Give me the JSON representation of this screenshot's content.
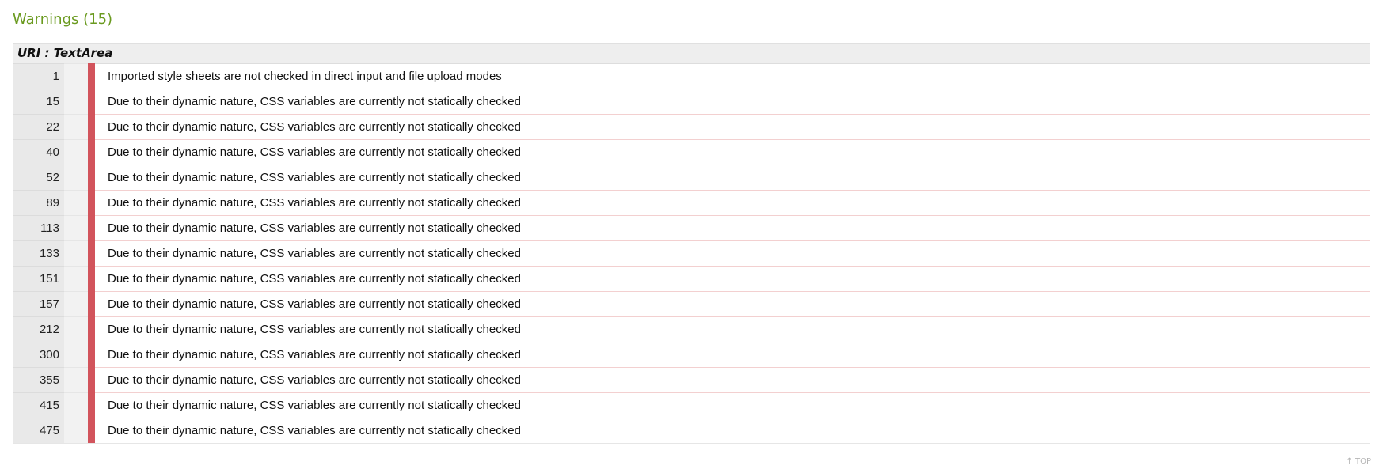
{
  "section": {
    "title": "Warnings (15)",
    "uri_label": "URI : TextArea"
  },
  "warnings": [
    {
      "line": "1",
      "message": "Imported style sheets are not checked in direct input and file upload modes"
    },
    {
      "line": "15",
      "message": "Due to their dynamic nature, CSS variables are currently not statically checked"
    },
    {
      "line": "22",
      "message": "Due to their dynamic nature, CSS variables are currently not statically checked"
    },
    {
      "line": "40",
      "message": "Due to their dynamic nature, CSS variables are currently not statically checked"
    },
    {
      "line": "52",
      "message": "Due to their dynamic nature, CSS variables are currently not statically checked"
    },
    {
      "line": "89",
      "message": "Due to their dynamic nature, CSS variables are currently not statically checked"
    },
    {
      "line": "113",
      "message": "Due to their dynamic nature, CSS variables are currently not statically checked"
    },
    {
      "line": "133",
      "message": "Due to their dynamic nature, CSS variables are currently not statically checked"
    },
    {
      "line": "151",
      "message": "Due to their dynamic nature, CSS variables are currently not statically checked"
    },
    {
      "line": "157",
      "message": "Due to their dynamic nature, CSS variables are currently not statically checked"
    },
    {
      "line": "212",
      "message": "Due to their dynamic nature, CSS variables are currently not statically checked"
    },
    {
      "line": "300",
      "message": "Due to their dynamic nature, CSS variables are currently not statically checked"
    },
    {
      "line": "355",
      "message": "Due to their dynamic nature, CSS variables are currently not statically checked"
    },
    {
      "line": "415",
      "message": "Due to their dynamic nature, CSS variables are currently not statically checked"
    },
    {
      "line": "475",
      "message": "Due to their dynamic nature, CSS variables are currently not statically checked"
    }
  ],
  "footer": {
    "top_link_label": "↑ TOP"
  },
  "colors": {
    "title_green": "#6a9a1f",
    "warning_bar": "#d2545c",
    "row_separator": "#f3d0d0"
  }
}
